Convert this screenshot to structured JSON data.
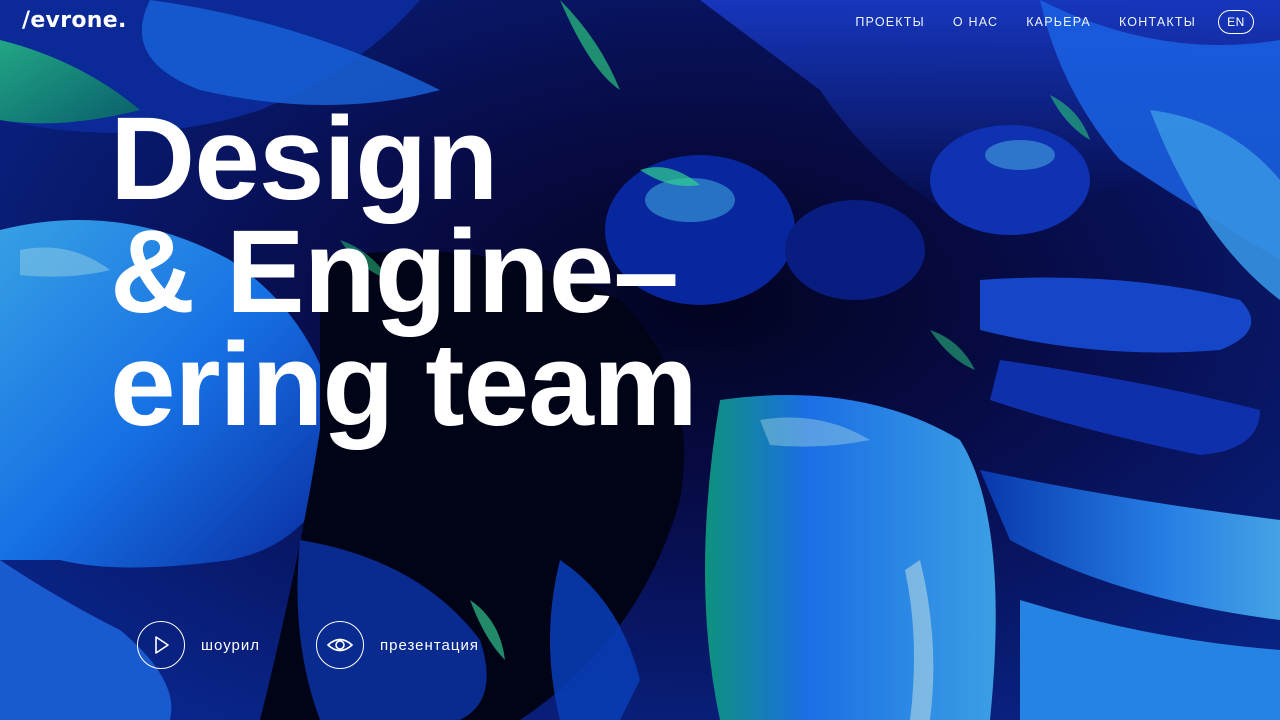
{
  "header": {
    "logo": "/evrone.",
    "nav": [
      {
        "label": "ПРОЕКТЫ"
      },
      {
        "label": "О НАС"
      },
      {
        "label": "КАРЬЕРА"
      },
      {
        "label": "КОНТАКТЫ"
      }
    ],
    "lang_label": "EN"
  },
  "hero": {
    "line1": "Design",
    "line2": "& Engine–",
    "line3": "ering team"
  },
  "actions": {
    "showreel": {
      "label": "шоурил",
      "icon": "play-icon"
    },
    "presentation": {
      "label": "презентация",
      "icon": "eye-icon"
    }
  },
  "colors": {
    "background_dark": "#020418",
    "accent_blue": "#1e7bff",
    "accent_green": "#22c98a",
    "text": "#ffffff"
  }
}
